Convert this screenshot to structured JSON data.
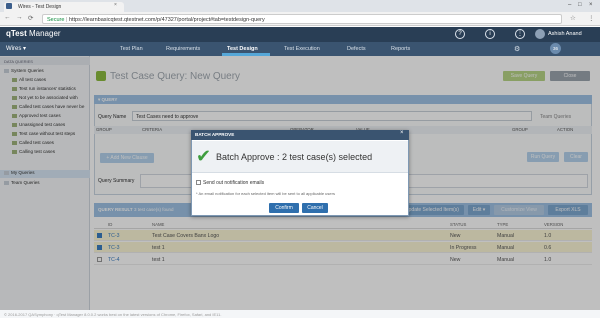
{
  "browser": {
    "tab_title": "Wires - Test Design",
    "close_tab": "×",
    "secure_label": "Secure",
    "url": "https://learnbasicqtest.qtestnet.com/p/47327/portal/project#tab=testdesign-query",
    "back": "←",
    "forward": "→",
    "reload": "⟳",
    "star": "☆",
    "menu": "⋮"
  },
  "app": {
    "logo_q": "qTest",
    "logo_rest": "Manager",
    "project": "Wires ▾",
    "user_name": "Ashish Anand",
    "notification_count": "36"
  },
  "nav": {
    "items": [
      "Test Plan",
      "Requirements",
      "Test Design",
      "Test Execution",
      "Defects",
      "Reports"
    ]
  },
  "sidebar": {
    "header": "DATA QUERIES",
    "system_queries": "System Queries",
    "items": [
      "All test cases",
      "Test run instances' statistics",
      "Not yet to be associated with",
      "Called test cases have never be",
      "Approved test cases",
      "Unassigned test cases",
      "Test case without test steps",
      "Called test cases",
      "Calling test cases"
    ],
    "my_queries": "My Queries",
    "team_queries": "Team Queries"
  },
  "page": {
    "title": "Test Case Query: New Query",
    "save_button": "Save Query",
    "close_button": "Close"
  },
  "query": {
    "panel_title": "▾ QUERY",
    "name_label": "Query Name",
    "name_value": "Test Cases need to approve",
    "team_queries": "Team Queries",
    "columns": [
      "GROUP",
      "CRITERIA",
      "OPERATOR",
      "VALUE",
      "GROUP",
      "ACTION"
    ],
    "add_clause": "+  Add New Clause",
    "run_query": "Run Query",
    "clear": "Clear",
    "summary_label": "Query Summary"
  },
  "results": {
    "title": "QUERY RESULT",
    "found": "3 test case(s) found",
    "btn_update": "Update Selected Item(s)",
    "btn_edit": "Edit ▾",
    "btn_customize": "Customize View",
    "btn_export": "Export XLS",
    "headers": [
      "ID",
      "NAME",
      "STATUS",
      "TYPE",
      "VERSION"
    ],
    "rows": [
      {
        "id": "TC-3",
        "name": "Test Case Covers Banx Logo",
        "status": "New",
        "type": "Manual",
        "version": "1.0"
      },
      {
        "id": "TC-3",
        "name": "test 1",
        "status": "In Progress",
        "type": "Manual",
        "version": "0.6"
      },
      {
        "id": "TC-4",
        "name": "test 1",
        "status": "New",
        "type": "Manual",
        "version": "1.0"
      }
    ]
  },
  "modal": {
    "title": "BATCH APPROVE",
    "close": "×",
    "check": "✔",
    "message": "Batch Approve : 2 test case(s) selected",
    "notify_label": "Send out notification emails",
    "note": "* An email notification for each selected item will be sent to all applicable users",
    "confirm": "Confirm",
    "cancel": "Cancel"
  },
  "footer": {
    "text": "© 2016-2017 QASymphony · qTest Manager 8.0.0.2 works best on the latest versions of Chrome, Firefox, Safari, and IE11."
  },
  "colors": {
    "header_bg": "#293e55",
    "menu_bg": "#3a5470",
    "accent_blue": "#9fc2e4",
    "confirm_btn": "#2f6fad",
    "check_green": "#3e9d3e"
  }
}
